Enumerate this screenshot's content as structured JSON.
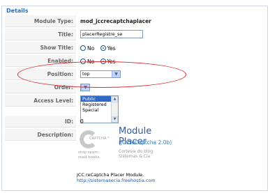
{
  "fieldset": {
    "legend": "Details"
  },
  "rows": {
    "module_type": {
      "label": "Module Type:",
      "value": "mod_jccrecaptchaplacer"
    },
    "title": {
      "label": "Title:",
      "value": "placerRegistre_se"
    },
    "show_title": {
      "label": "Show Title:",
      "no": "No",
      "yes": "Yes",
      "selected": "Yes"
    },
    "enabled": {
      "label": "Enabled:",
      "no": "No",
      "yes": "Yes",
      "selected": "Yes"
    },
    "position": {
      "label": "Position:",
      "value": "top"
    },
    "order": {
      "label": "Order:",
      "value": ""
    },
    "access_level": {
      "label": "Access Level:",
      "options": [
        "Public",
        "Registered",
        "Special"
      ],
      "selected": "Public"
    },
    "id": {
      "label": "ID:",
      "value": "0"
    },
    "description": {
      "label": "Description:",
      "banner_tag": "CAPTCHA™",
      "banner_slogan": [
        "stop spam.",
        "read books."
      ],
      "banner_title": "Module Placer",
      "banner_subtitle": "(JCCreCaptcha 2.0b)",
      "banner_credit": [
        "Cortesia do blog",
        "Sistemas & Cia"
      ],
      "text": "JCC reCaptcha Placer Module.",
      "link": "http://sistemasecia.freehostia.com"
    }
  },
  "annotation": {
    "color": "#d9272b"
  }
}
